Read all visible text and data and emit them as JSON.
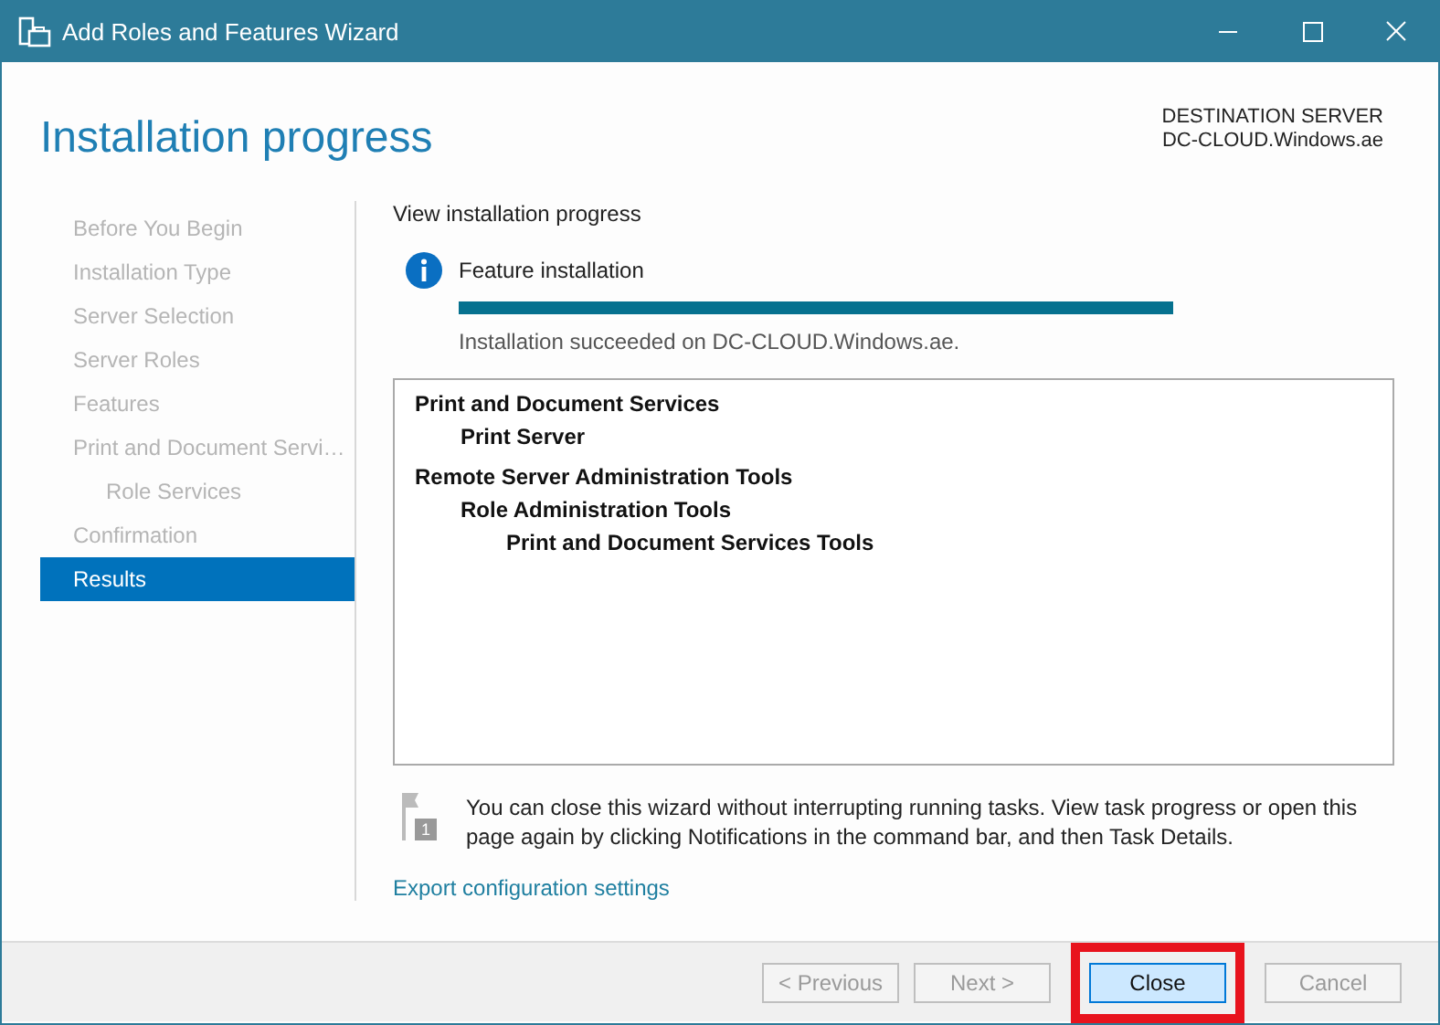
{
  "window": {
    "title": "Add Roles and Features Wizard"
  },
  "page_title": "Installation progress",
  "destination": {
    "label": "DESTINATION SERVER",
    "server": "DC-CLOUD.Windows.ae"
  },
  "steps": [
    {
      "label": "Before You Begin",
      "selected": false
    },
    {
      "label": "Installation Type",
      "selected": false
    },
    {
      "label": "Server Selection",
      "selected": false
    },
    {
      "label": "Server Roles",
      "selected": false
    },
    {
      "label": "Features",
      "selected": false
    },
    {
      "label": "Print and Document Servi…",
      "selected": false,
      "children": [
        {
          "label": "Role Services",
          "selected": false
        }
      ]
    },
    {
      "label": "Confirmation",
      "selected": false
    },
    {
      "label": "Results",
      "selected": true
    }
  ],
  "section_title": "View installation progress",
  "progress": {
    "label": "Feature installation",
    "level": 1,
    "status": "Installation succeeded on DC-CLOUD.Windows.ae."
  },
  "results": [
    {
      "label": "Print and Document Services",
      "children": [
        {
          "label": "Print Server"
        }
      ]
    },
    {
      "label": "Remote Server Administration Tools",
      "children": [
        {
          "label": "Role Administration Tools",
          "children": [
            {
              "label": "Print and Document Services Tools"
            }
          ]
        }
      ]
    }
  ],
  "note": {
    "text": "You can close this wizard without interrupting running tasks. View task progress or open this page again by clicking Notifications in the command bar, and then Task Details.",
    "badge": "1"
  },
  "export_link": "Export configuration settings",
  "buttons": [
    {
      "label": "< Previous",
      "disabled": true,
      "default": false,
      "highlighted": false
    },
    {
      "label": "Next >",
      "disabled": true,
      "default": false,
      "highlighted": false
    },
    {
      "label": "Close",
      "disabled": false,
      "default": true,
      "highlighted": true
    },
    {
      "label": "Cancel",
      "disabled": true,
      "default": false,
      "highlighted": false
    }
  ]
}
